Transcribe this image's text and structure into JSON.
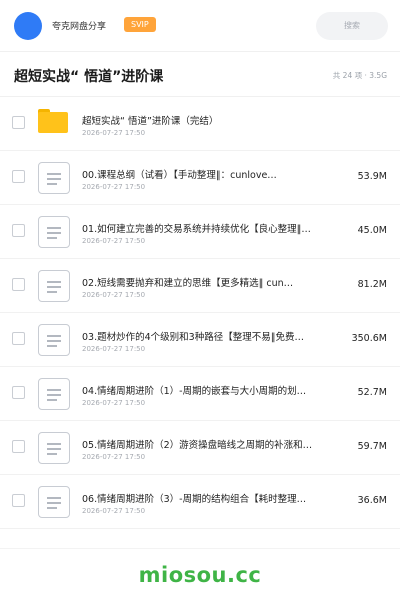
{
  "header": {
    "brand": "夸克网盘分享",
    "badge": "SVIP",
    "search_label": "搜索"
  },
  "folder": {
    "title": "超短实战“ 悟道”进阶课",
    "meta": "共 24 项 · 3.5G"
  },
  "colors": {
    "avatar": "#2f7bf6",
    "badge": "#ffa43a",
    "folder_icon": "#ffc21a",
    "watermark": "#3fb446"
  },
  "items": [
    {
      "type": "folder",
      "icon": "folder-icon",
      "name": "超短实战“ 悟道”进阶课（完结）",
      "date": "2026-07-27 17:50",
      "size": ""
    },
    {
      "type": "file",
      "icon": "document-icon",
      "name": "00.课程总纲（试看）【手动整理‖：cunlove…",
      "date": "2026-07-27 17:50",
      "size": "53.9M"
    },
    {
      "type": "file",
      "icon": "document-icon",
      "name": "01.如何建立完善的交易系统并持续优化【良心整理‖…",
      "date": "2026-07-27 17:50",
      "size": "45.0M"
    },
    {
      "type": "file",
      "icon": "document-icon",
      "name": "02.短线需要抛弃和建立的思维【更多精选‖ cun…",
      "date": "2026-07-27 17:50",
      "size": "81.2M"
    },
    {
      "type": "file",
      "icon": "document-icon",
      "name": "03.题材炒作的4个级别和3种路径【整理不易‖免费…",
      "date": "2026-07-27 17:50",
      "size": "350.6M"
    },
    {
      "type": "file",
      "icon": "document-icon",
      "name": "04.情绪周期进阶（1）-周期的嵌套与大小周期的划…",
      "date": "2026-07-27 17:50",
      "size": "52.7M"
    },
    {
      "type": "file",
      "icon": "document-icon",
      "name": "05.情绪周期进阶（2）游资操盘暗线之周期的补涨和…",
      "date": "2026-07-27 17:50",
      "size": "59.7M"
    },
    {
      "type": "file",
      "icon": "document-icon",
      "name": "06.情绪周期进阶（3）-周期的结构组合【耗时整理…",
      "date": "2026-07-27 17:50",
      "size": "36.6M"
    }
  ],
  "footer": {
    "watermark": "miosou.cc"
  }
}
